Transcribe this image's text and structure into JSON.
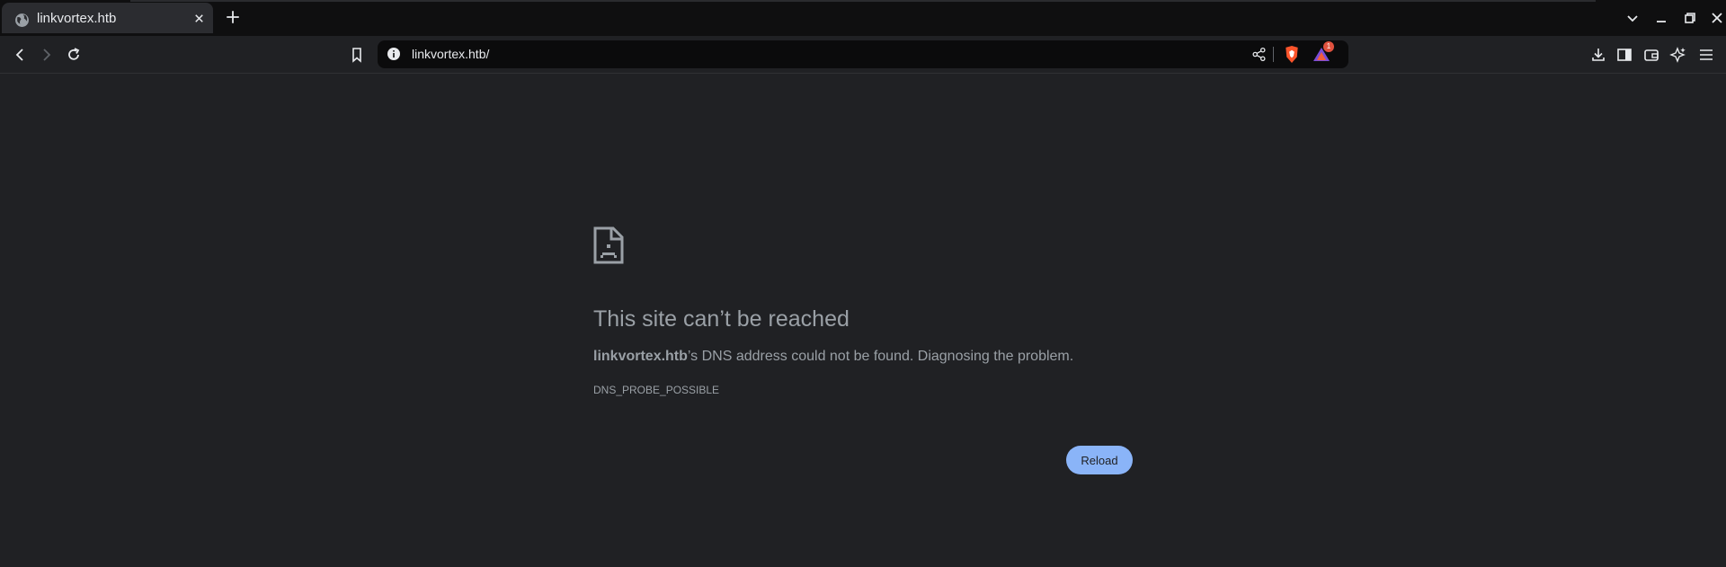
{
  "tabs": [
    {
      "title": "linkvortex.htb",
      "icon": "globe-icon",
      "active": true
    }
  ],
  "toolbar": {
    "url": "linkvortex.htb/",
    "rewards_badge": "1"
  },
  "error_page": {
    "title": "This site can’t be reached",
    "host": "linkvortex.htb",
    "description_rest": "’s DNS address could not be found. Diagnosing the problem.",
    "error_code": "DNS_PROBE_POSSIBLE",
    "reload_label": "Reload"
  },
  "colors": {
    "background": "#202124",
    "tabstrip": "#0f0f10",
    "accent_button": "#8ab4f8",
    "text": "#9aa0a6"
  }
}
